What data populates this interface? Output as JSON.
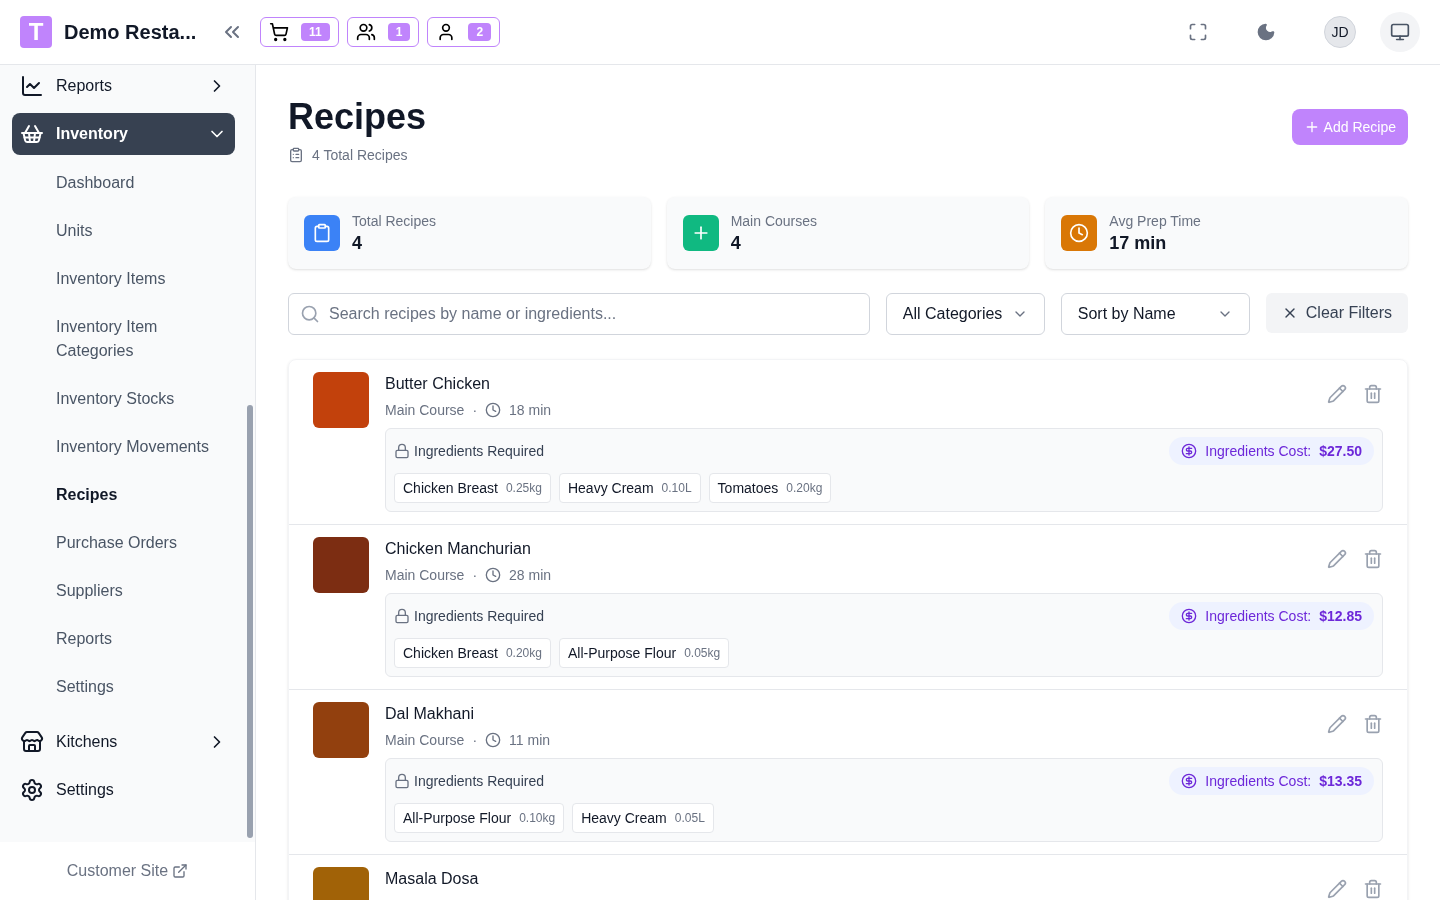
{
  "brand": {
    "logo": "T",
    "name": "Demo Resta..."
  },
  "header_badges": [
    {
      "kind": "cart",
      "count": "11"
    },
    {
      "kind": "host",
      "count": "1"
    },
    {
      "kind": "waiter",
      "count": "2"
    }
  ],
  "user": {
    "initials": "JD"
  },
  "sidebar": {
    "items": [
      {
        "label": "Reports",
        "expanded": false,
        "selected": false
      },
      {
        "label": "Inventory",
        "expanded": true,
        "selected": true,
        "children": [
          {
            "label": "Dashboard",
            "selected": false
          },
          {
            "label": "Units",
            "selected": false
          },
          {
            "label": "Inventory Items",
            "selected": false
          },
          {
            "label": "Inventory Item Categories",
            "selected": false
          },
          {
            "label": "Inventory Stocks",
            "selected": false
          },
          {
            "label": "Inventory Movements",
            "selected": false
          },
          {
            "label": "Recipes",
            "selected": true
          },
          {
            "label": "Purchase Orders",
            "selected": false
          },
          {
            "label": "Suppliers",
            "selected": false
          },
          {
            "label": "Reports",
            "selected": false
          },
          {
            "label": "Settings",
            "selected": false
          }
        ]
      },
      {
        "label": "Kitchens",
        "expanded": false,
        "selected": false
      },
      {
        "label": "Settings",
        "selected": false
      }
    ],
    "footer_link": "Customer Site"
  },
  "page": {
    "title": "Recipes",
    "subtitle": "4 Total Recipes",
    "add_button": "Add Recipe"
  },
  "stats": [
    {
      "kind": "clipboard",
      "label": "Total Recipes",
      "value": "4",
      "color": "#3b82f6"
    },
    {
      "kind": "plus",
      "label": "Main Courses",
      "value": "4",
      "color": "#10b981"
    },
    {
      "kind": "clock",
      "label": "Avg Prep Time",
      "value": "17 min",
      "color": "#d97706"
    }
  ],
  "filters": {
    "search_placeholder": "Search recipes by name or ingredients...",
    "category": "All Categories",
    "sort": "Sort by Name",
    "clear": "Clear Filters"
  },
  "recipes": [
    {
      "name": "Butter Chicken",
      "category": "Main Course",
      "separator": "·",
      "time": "18 min",
      "ingredients_label": "Ingredients Required",
      "cost_label": "Ingredients Cost:",
      "cost": "$27.50",
      "ingredients": [
        {
          "name": "Chicken Breast",
          "qty": "0.25kg"
        },
        {
          "name": "Heavy Cream",
          "qty": "0.10L"
        },
        {
          "name": "Tomatoes",
          "qty": "0.20kg"
        }
      ]
    },
    {
      "name": "Chicken Manchurian",
      "category": "Main Course",
      "separator": "·",
      "time": "28 min",
      "ingredients_label": "Ingredients Required",
      "cost_label": "Ingredients Cost:",
      "cost": "$12.85",
      "ingredients": [
        {
          "name": "Chicken Breast",
          "qty": "0.20kg"
        },
        {
          "name": "All-Purpose Flour",
          "qty": "0.05kg"
        }
      ]
    },
    {
      "name": "Dal Makhani",
      "category": "Main Course",
      "separator": "·",
      "time": "11 min",
      "ingredients_label": "Ingredients Required",
      "cost_label": "Ingredients Cost:",
      "cost": "$13.35",
      "ingredients": [
        {
          "name": "All-Purpose Flour",
          "qty": "0.10kg"
        },
        {
          "name": "Heavy Cream",
          "qty": "0.05L"
        }
      ]
    },
    {
      "name": "Masala Dosa"
    }
  ]
}
